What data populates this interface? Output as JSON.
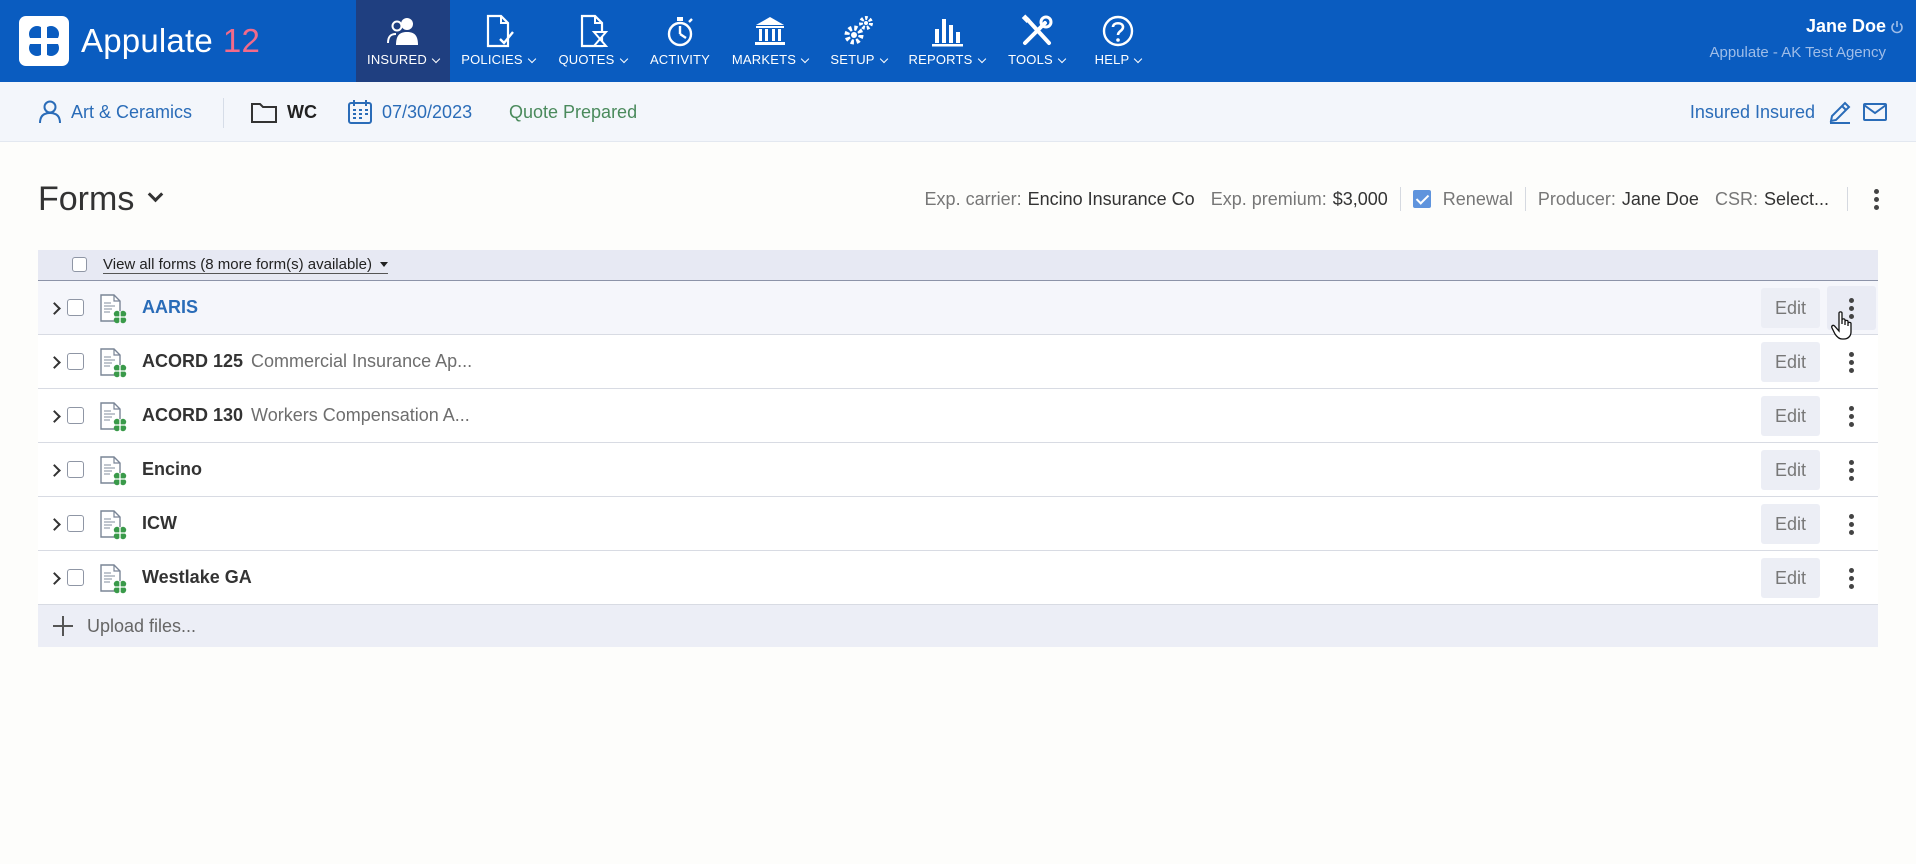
{
  "app": {
    "name": "Appulate",
    "version": "12"
  },
  "nav": [
    {
      "id": "insured",
      "label": "INSURED",
      "icon": "insured-users-icon",
      "dropdown": true,
      "active": true
    },
    {
      "id": "policies",
      "label": "POLICIES",
      "icon": "policy-document-icon",
      "dropdown": true,
      "active": false
    },
    {
      "id": "quotes",
      "label": "QUOTES",
      "icon": "quote-hourglass-icon",
      "dropdown": true,
      "active": false
    },
    {
      "id": "activity",
      "label": "ACTIVITY",
      "icon": "activity-stopwatch-icon",
      "dropdown": false,
      "active": false
    },
    {
      "id": "markets",
      "label": "MARKETS",
      "icon": "markets-bank-icon",
      "dropdown": true,
      "active": false
    },
    {
      "id": "setup",
      "label": "SETUP",
      "icon": "setup-gears-icon",
      "dropdown": true,
      "active": false
    },
    {
      "id": "reports",
      "label": "REPORTS",
      "icon": "reports-barchart-icon",
      "dropdown": true,
      "active": false
    },
    {
      "id": "tools",
      "label": "TOOLS",
      "icon": "tools-wrench-icon",
      "dropdown": true,
      "active": false
    },
    {
      "id": "help",
      "label": "HELP",
      "icon": "help-question-icon",
      "dropdown": true,
      "active": false
    }
  ],
  "user": {
    "name": "Jane Doe",
    "agency": "Appulate - AK Test Agency"
  },
  "context": {
    "insured": "Art & Ceramics",
    "line": "WC",
    "date": "07/30/2023",
    "status": "Quote Prepared",
    "contact": "Insured Insured"
  },
  "forms_header": {
    "title": "Forms",
    "exp_carrier_label": "Exp. carrier:",
    "exp_carrier_value": "Encino Insurance Co",
    "exp_premium_label": "Exp. premium:",
    "exp_premium_value": "$3,000",
    "renewal_label": "Renewal",
    "renewal_checked": true,
    "producer_label": "Producer:",
    "producer_value": "Jane Doe",
    "csr_label": "CSR:",
    "csr_value": "Select..."
  },
  "table": {
    "view_all_label": "View all forms (8 more form(s) available)",
    "edit_label": "Edit",
    "rows": [
      {
        "name": "AARIS",
        "desc": "",
        "link": true
      },
      {
        "name": "ACORD 125",
        "desc": "Commercial Insurance Ap...",
        "link": false
      },
      {
        "name": "ACORD 130",
        "desc": "Workers Compensation A...",
        "link": false
      },
      {
        "name": "Encino",
        "desc": "",
        "link": false
      },
      {
        "name": "ICW",
        "desc": "",
        "link": false
      },
      {
        "name": "Westlake GA",
        "desc": "",
        "link": false
      }
    ],
    "upload_label": "Upload files..."
  },
  "colors": {
    "topbar": "#0a5cc0",
    "nav_active": "#1f3f80",
    "accent_link": "#2a6cb8",
    "status_green": "#4a8a5c",
    "version_pink": "#f26a8a",
    "form_icon_green": "#3a9a4a"
  }
}
